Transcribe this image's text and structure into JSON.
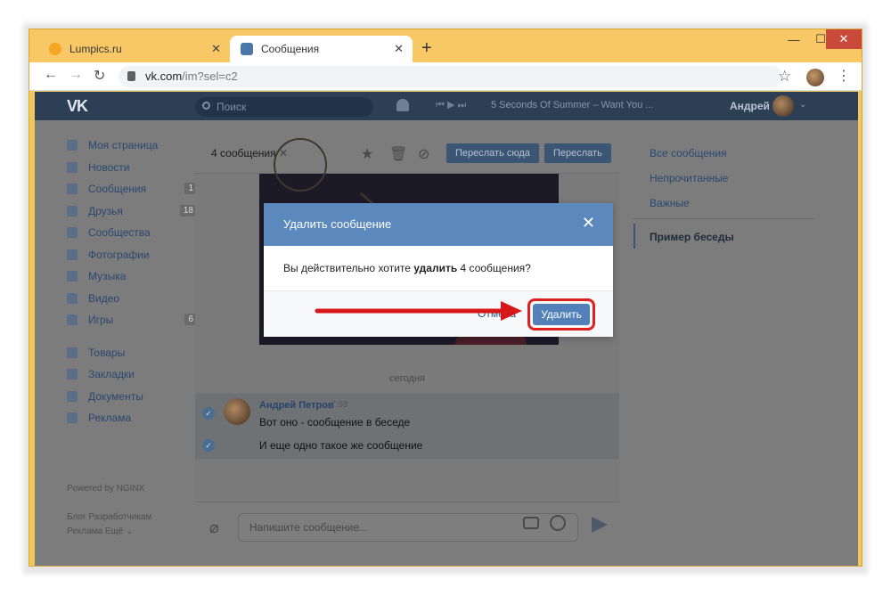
{
  "browser": {
    "tabs": [
      {
        "title": "Lumpics.ru",
        "favicon_color": "#f5a623"
      },
      {
        "title": "Сообщения",
        "favicon_color": "#4a76a8"
      }
    ],
    "url_host": "vk.com",
    "url_path": "/im?sel=c2",
    "close_glyph": "✕",
    "newtab_glyph": "+"
  },
  "vk_header": {
    "logo": "VK",
    "search_placeholder": "Поиск",
    "song": "5 Seconds Of Summer – Want You ...",
    "user_name": "Андрей"
  },
  "left_menu": {
    "items": [
      {
        "label": "Моя страница",
        "count": ""
      },
      {
        "label": "Новости",
        "count": ""
      },
      {
        "label": "Сообщения",
        "count": "1"
      },
      {
        "label": "Друзья",
        "count": "18"
      },
      {
        "label": "Сообщества",
        "count": ""
      },
      {
        "label": "Фотографии",
        "count": ""
      },
      {
        "label": "Музыка",
        "count": ""
      },
      {
        "label": "Видео",
        "count": ""
      },
      {
        "label": "Игры",
        "count": "6"
      }
    ],
    "items2": [
      {
        "label": "Товары"
      },
      {
        "label": "Закладки"
      },
      {
        "label": "Документы"
      },
      {
        "label": "Реклама"
      }
    ],
    "powered": "Powered by NGINX",
    "footer_line1": "Блог   Разработчикам",
    "footer_line2": "Реклама   Ещё ⌄"
  },
  "chat": {
    "selected_count": "4 сообщения",
    "forward_here": "Переслать сюда",
    "forward": "Переслать",
    "today": "сегодня",
    "author": "Андрей Петров",
    "time": "7:58",
    "message1": "Вот оно - сообщение в беседе",
    "message2": "И еще одно такое же сообщение",
    "composer_placeholder": "Напишите сообщение..."
  },
  "right_panel": {
    "items": [
      "Все сообщения",
      "Непрочитанные",
      "Важные"
    ],
    "active": "Пример беседы"
  },
  "modal": {
    "title": "Удалить сообщение",
    "body_pre": "Вы действительно хотите ",
    "body_bold": "удалить",
    "body_post": " 4 сообщения?",
    "cancel": "Отмена",
    "delete": "Удалить"
  },
  "colors": {
    "modal_header": "#5b88bd",
    "delete_button": "#5181b8",
    "highlight": "#e02020",
    "vk_header": "#2d3f55"
  }
}
